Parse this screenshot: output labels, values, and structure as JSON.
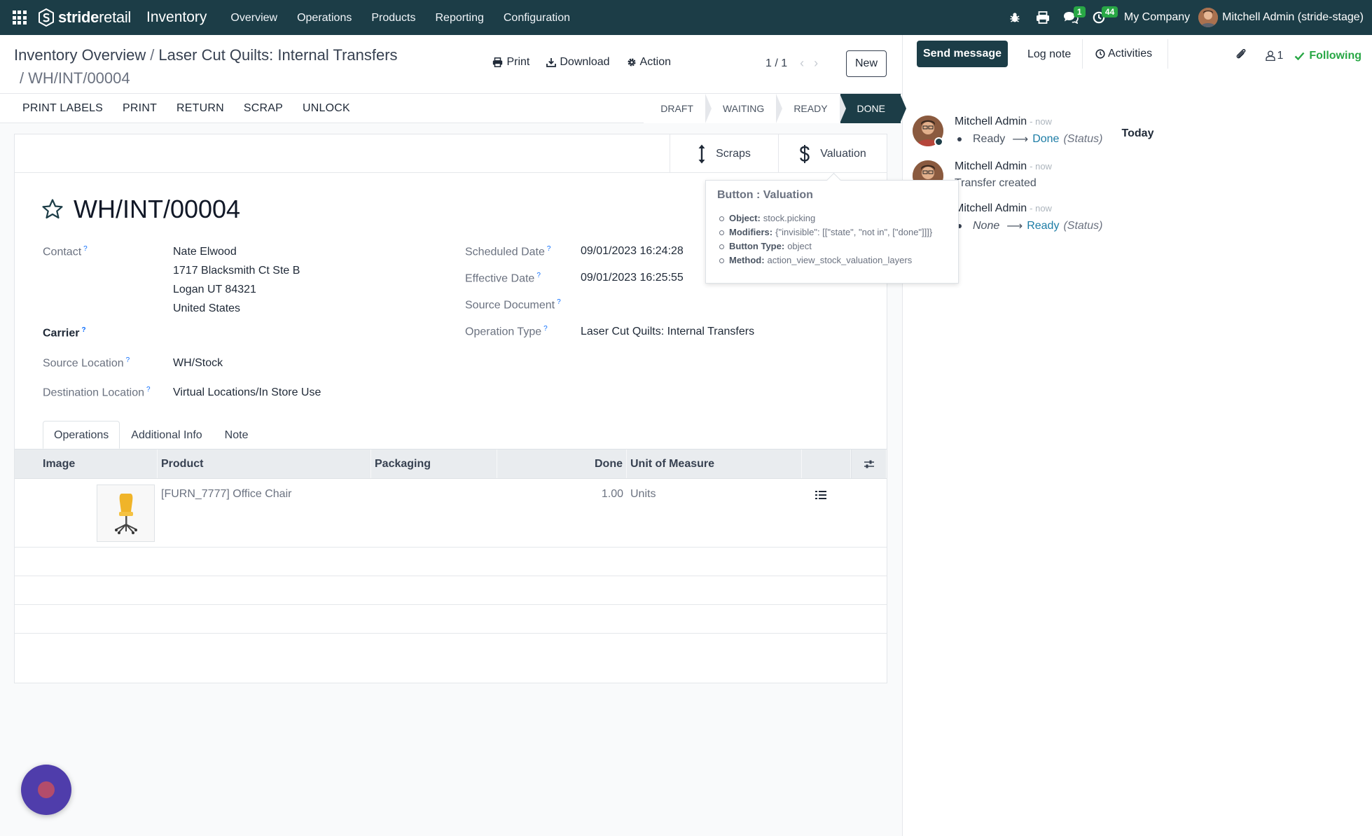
{
  "navbar": {
    "brand_bold": "stride",
    "brand_light": "retail",
    "app_name": "Inventory",
    "menu": [
      "Overview",
      "Operations",
      "Products",
      "Reporting",
      "Configuration"
    ],
    "chat_badge": "1",
    "activity_badge": "44",
    "company": "My Company",
    "user": "Mitchell Admin (stride-stage)",
    "icons": [
      "apps-grid-icon",
      "bug-icon",
      "print-icon",
      "chat-icon",
      "clock-icon"
    ]
  },
  "breadcrumb": {
    "parts": [
      "Inventory Overview",
      "Laser Cut Quilts: Internal Transfers"
    ],
    "current": "WH/INT/00004"
  },
  "control": {
    "print": "Print",
    "download": "Download",
    "action": "Action",
    "pager": "1 / 1",
    "new": "New"
  },
  "statusbar": {
    "buttons": [
      "Print Labels",
      "Print",
      "Return",
      "Scrap",
      "Unlock"
    ],
    "stages": [
      "DRAFT",
      "WAITING",
      "READY",
      "DONE"
    ],
    "active_stage": "DONE"
  },
  "smart_buttons": {
    "scraps": "Scraps",
    "valuation": "Valuation"
  },
  "record": {
    "name": "WH/INT/00004",
    "fields": {
      "contact_label": "Contact",
      "contact_name": "Nate Elwood",
      "address": [
        "1717 Blacksmith Ct Ste B",
        "Logan UT 84321",
        "United States"
      ],
      "carrier_label": "Carrier",
      "source_location_label": "Source Location",
      "source_location": "WH/Stock",
      "destination_location_label": "Destination Location",
      "destination_location": "Virtual Locations/In Store Use",
      "scheduled_date_label": "Scheduled Date",
      "scheduled_date": "09/01/2023 16:24:28",
      "effective_date_label": "Effective Date",
      "effective_date": "09/01/2023 16:25:55",
      "source_document_label": "Source Document",
      "operation_type_label": "Operation Type",
      "operation_type": "Laser Cut Quilts: Internal Transfers",
      "help_mark": "?"
    }
  },
  "tabs": [
    "Operations",
    "Additional Info",
    "Note"
  ],
  "active_tab": "Operations",
  "operations_table": {
    "columns": [
      "Image",
      "Product",
      "Packaging",
      "Done",
      "Unit of Measure"
    ],
    "rows": [
      {
        "product": "[FURN_7777] Office Chair",
        "packaging": "",
        "done": "1.00",
        "uom": "Units"
      }
    ]
  },
  "tooltip": {
    "title": "Button : Valuation",
    "items": [
      {
        "key": "Object:",
        "value": "stock.picking"
      },
      {
        "key": "Modifiers:",
        "value": "{\"invisible\": [[\"state\", \"not in\", [\"done\"]]]}"
      },
      {
        "key": "Button Type:",
        "value": "object"
      },
      {
        "key": "Method:",
        "value": "action_view_stock_valuation_layers"
      }
    ]
  },
  "chatter": {
    "send_message": "Send message",
    "log_note": "Log note",
    "activities": "Activities",
    "followers_count": "1",
    "following": "Following",
    "today": "Today",
    "messages": [
      {
        "author": "Mitchell Admin",
        "time": "- now",
        "old": "Ready",
        "new": "Done",
        "field": "(Status)"
      },
      {
        "author": "Mitchell Admin",
        "time": "- now",
        "text": "Transfer created"
      },
      {
        "author": "Mitchell Admin",
        "time": "- now",
        "old": "None",
        "new": "Ready",
        "field": "(Status)"
      }
    ]
  },
  "colors": {
    "navbar": "#1c3d47",
    "accent_green": "#28a745",
    "link_blue": "#1c7ca5",
    "chat_bubble": "#4f3dab"
  }
}
